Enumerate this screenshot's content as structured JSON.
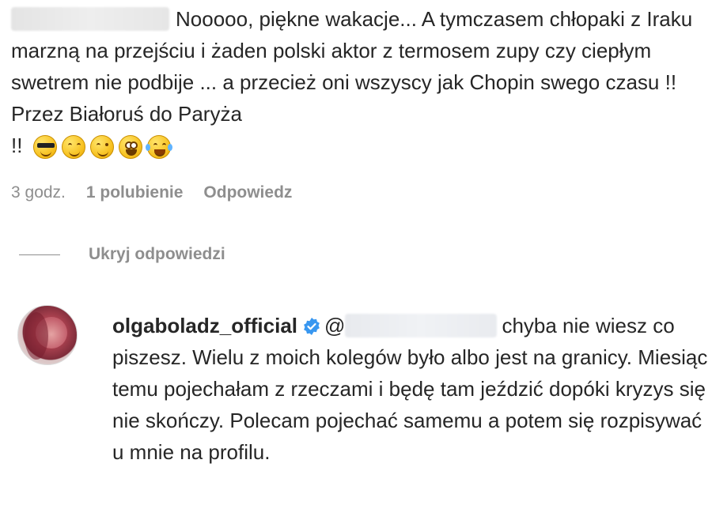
{
  "comment": {
    "text_line": "Nooooo, piękne wakacje... A tymczasem chłopaki z Iraku marzną na przejściu i żaden polski aktor z termosem zupy czy ciepłym swetrem nie podbije ... a przecież oni wszyscy jak Chopin swego czasu !! Przez Białoruś do Paryża",
    "suffix": "!!",
    "emojis": [
      "sunglasses-emoji",
      "smiling-emoji",
      "winking-emoji",
      "zany-emoji",
      "joy-emoji"
    ]
  },
  "meta": {
    "time": "3 godz.",
    "likes": "1 polubienie",
    "reply": "Odpowiedz"
  },
  "replies_toggle": {
    "label": "Ukryj odpowiedzi"
  },
  "reply": {
    "username": "olgaboladz_official",
    "verified_icon": "verified-badge-icon",
    "mention_prefix": "@",
    "text": "chyba nie wiesz co piszesz. Wielu z moich kolegów było albo jest na granicy. Miesiąc temu pojechałam z rzeczami i będę tam jeździć dopóki kryzys się nie skończy. Polecam pojechać samemu a potem się rozpisywać u mnie na profilu."
  },
  "colors": {
    "text": "#262626",
    "secondary": "#8e8e8e",
    "verified": "#3897f0"
  }
}
